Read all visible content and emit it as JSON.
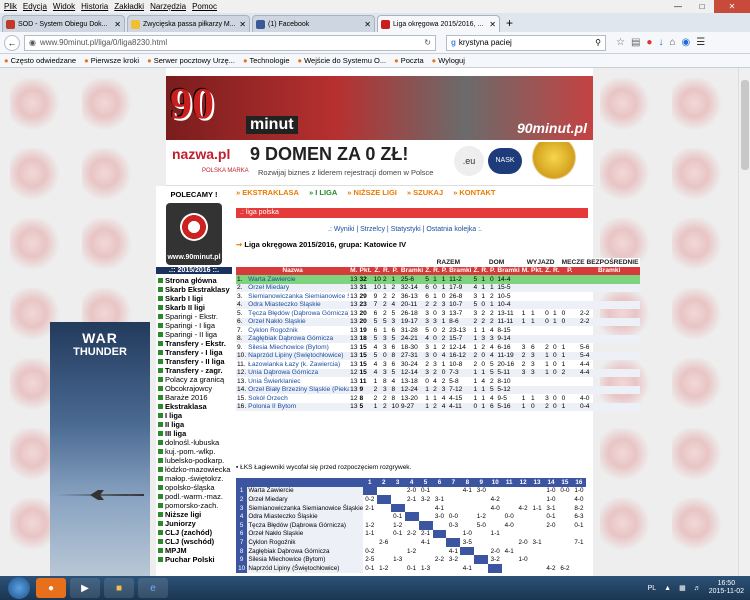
{
  "menu": [
    "Plik",
    "Edycja",
    "Widok",
    "Historia",
    "Zakładki",
    "Narzędzia",
    "Pomoc"
  ],
  "tabs": [
    {
      "label": "SOD - System Obiegu Dok...",
      "color": "#c0392b",
      "active": false
    },
    {
      "label": "Zwycięska passa piłkarzy M...",
      "color": "#f0c030",
      "active": false
    },
    {
      "label": "(1) Facebook",
      "color": "#3b5998",
      "active": false
    },
    {
      "label": "Liga okręgowa 2015/2016, ...",
      "color": "#c81e1e",
      "active": true
    }
  ],
  "url": "www.90minut.pl/liga/0/liga8230.html",
  "search_value": "krystyna paciej",
  "bookmarks": [
    "Często odwiedzane",
    "Pierwsze kroki",
    "Serwer pocztowy Urzę...",
    "Technologie",
    "Wejście do Systemu O...",
    "Poczta",
    "Wyloguj"
  ],
  "banner": {
    "logo": "90",
    "minut": "minut",
    "site": "90minut.pl"
  },
  "ad": {
    "brand": "nazwa.pl",
    "polska": "POLSKA MARKA",
    "headline": "9 DOMEN ZA 0 ZŁ!",
    "sub": "Rozwijaj biznes z liderem rejestracji domen w Polsce",
    "eu": ".eu",
    "nask": "NASK"
  },
  "sidebar": {
    "polecamy": "POLECAMY !",
    "logo": "www.90minut.pl",
    "season": ".:: 2015/2016 ::.",
    "items": [
      {
        "label": "Strona główna",
        "bold": true,
        "sq": true
      },
      {
        "label": "Skarb Ekstraklasy",
        "bold": true,
        "sq": true
      },
      {
        "label": "Skarb I ligi",
        "bold": true,
        "sq": true
      },
      {
        "label": "Skarb II ligi",
        "bold": true,
        "sq": true
      },
      {
        "label": "Sparingi - Ekstr.",
        "bold": false,
        "sq": true
      },
      {
        "label": "Sparingi - I liga",
        "bold": false,
        "sq": true
      },
      {
        "label": "Sparingi - II liga",
        "bold": false,
        "sq": true
      },
      {
        "label": "Transfery - Ekstr.",
        "bold": true,
        "sq": true
      },
      {
        "label": "Transfery - I liga",
        "bold": true,
        "sq": true
      },
      {
        "label": "Transfery - II liga",
        "bold": true,
        "sq": true
      },
      {
        "label": "Transfery - zagr.",
        "bold": true,
        "sq": true
      },
      {
        "label": "Polacy za granicą",
        "bold": false,
        "sq": true
      },
      {
        "label": "Obcokrajowcy",
        "bold": false,
        "sq": true
      },
      {
        "label": "Baraże 2016",
        "bold": false,
        "sq": true
      },
      {
        "label": "Ekstraklasa",
        "bold": true,
        "sq": true
      },
      {
        "label": "I liga",
        "bold": true,
        "sq": true
      },
      {
        "label": "II liga",
        "bold": true,
        "sq": true
      },
      {
        "label": "III liga",
        "bold": true,
        "sq": true
      },
      {
        "label": "dolnośl.-lubuska",
        "bold": false,
        "sq": true
      },
      {
        "label": "kuj.-pom.-wlkp.",
        "bold": false,
        "sq": true
      },
      {
        "label": "lubelsko-podkarp.",
        "bold": false,
        "sq": true
      },
      {
        "label": "łódzko-mazowiecka",
        "bold": false,
        "sq": true
      },
      {
        "label": "małop.-świętokrz.",
        "bold": false,
        "sq": true
      },
      {
        "label": "opolsko-śląska",
        "bold": false,
        "sq": true
      },
      {
        "label": "podl.-warm.-maz.",
        "bold": false,
        "sq": true
      },
      {
        "label": "pomorsko-zach.",
        "bold": false,
        "sq": true
      },
      {
        "label": "Niższe ligi",
        "bold": true,
        "sq": true
      },
      {
        "label": "Juniorzy",
        "bold": true,
        "sq": true
      },
      {
        "label": "CLJ (zachód)",
        "bold": true,
        "sq": true
      },
      {
        "label": "CLJ (wschód)",
        "bold": true,
        "sq": true
      },
      {
        "label": "MPJM",
        "bold": true,
        "sq": true
      },
      {
        "label": "Puchar Polski",
        "bold": true,
        "sq": true
      }
    ]
  },
  "topnav": [
    {
      "label": "» EKSTRAKLASA",
      "cls": "a"
    },
    {
      "label": "» I LIGA",
      "cls": "g"
    },
    {
      "label": "» NIŻSZE LIGI",
      "cls": "a"
    },
    {
      "label": "» SZUKAJ",
      "cls": "a"
    },
    {
      "label": "» KONTAKT",
      "cls": "a"
    }
  ],
  "breadcrumb": ".: liga polska",
  "sublinks": ".: Wyniki | Strzelcy | Statystyki | Ostatnia kolejka :.",
  "league_title": "Liga okręgowa 2015/2016, grupa: Katowice IV",
  "groups": {
    "razem": "RAZEM",
    "dom": "DOM",
    "wyjazd": "WYJAZD",
    "mecze": "MECZE BEZPOŚREDNIE"
  },
  "headers": [
    "Nazwa",
    "M.",
    "Pkt.",
    "Z.",
    "R.",
    "P.",
    "Bramki",
    "Z.",
    "R.",
    "P.",
    "Bramki",
    "Z.",
    "R.",
    "P.",
    "Bramki",
    "M.",
    "Pkt.",
    "Z.",
    "R.",
    "P.",
    "Bramki"
  ],
  "standings": [
    [
      "1.",
      "Warta Zawiercie",
      "13",
      "32",
      "10",
      "2",
      "1",
      "25-6",
      "5",
      "1",
      "1",
      "11-2",
      "5",
      "1",
      "0",
      "14-4",
      "",
      "",
      "",
      "",
      "",
      ""
    ],
    [
      "2.",
      "Orzeł Miedary",
      "13",
      "31",
      "10",
      "1",
      "2",
      "32-14",
      "6",
      "0",
      "1",
      "17-9",
      "4",
      "1",
      "1",
      "15-5",
      "",
      "",
      "",
      "",
      "",
      ""
    ],
    [
      "3.",
      "Siemianowiczanka Siemianowice Śląskie",
      "13",
      "29",
      "9",
      "2",
      "2",
      "36-13",
      "6",
      "1",
      "0",
      "26-8",
      "3",
      "1",
      "2",
      "10-5",
      "",
      "",
      "",
      "",
      "",
      ""
    ],
    [
      "4.",
      "Odra Miasteczko Śląskie",
      "13",
      "23",
      "7",
      "2",
      "4",
      "20-11",
      "2",
      "2",
      "3",
      "10-7",
      "5",
      "0",
      "1",
      "10-4",
      "",
      "",
      "",
      "",
      "",
      ""
    ],
    [
      "5.",
      "Tęcza Błędów (Dąbrowa Górnicza)",
      "13",
      "20",
      "6",
      "2",
      "5",
      "26-18",
      "3",
      "0",
      "3",
      "13-7",
      "3",
      "2",
      "2",
      "13-11",
      "1",
      "1",
      "0",
      "1",
      "0",
      "2-2"
    ],
    [
      "6.",
      "Orzeł Nakło Śląskie",
      "13",
      "20",
      "5",
      "5",
      "3",
      "19-17",
      "3",
      "3",
      "1",
      "8-6",
      "2",
      "2",
      "2",
      "11-11",
      "1",
      "1",
      "0",
      "1",
      "0",
      "2-2"
    ],
    [
      "7.",
      "Cyklon Rogoźnik",
      "13",
      "19",
      "6",
      "1",
      "6",
      "31-28",
      "5",
      "0",
      "2",
      "23-13",
      "1",
      "1",
      "4",
      "8-15",
      "",
      "",
      "",
      "",
      "",
      ""
    ],
    [
      "8.",
      "Zagłębiak Dąbrowa Górnicza",
      "13",
      "18",
      "5",
      "3",
      "5",
      "24-21",
      "4",
      "0",
      "2",
      "15-7",
      "1",
      "3",
      "3",
      "9-14",
      "",
      "",
      "",
      "",
      "",
      ""
    ],
    [
      "9.",
      "Silesia Miechowice (Bytom)",
      "13",
      "15",
      "4",
      "3",
      "6",
      "18-30",
      "3",
      "1",
      "2",
      "12-14",
      "1",
      "2",
      "4",
      "6-16",
      "3",
      "6",
      "2",
      "0",
      "1",
      "5-6"
    ],
    [
      "10.",
      "Naprzód Lipiny (Świętochłowice)",
      "13",
      "15",
      "5",
      "0",
      "8",
      "27-31",
      "3",
      "0",
      "4",
      "16-12",
      "2",
      "0",
      "4",
      "11-19",
      "2",
      "3",
      "1",
      "0",
      "1",
      "5-4"
    ],
    [
      "11.",
      "Łazowianka Łazy (k. Zawiercia)",
      "13",
      "15",
      "4",
      "3",
      "6",
      "30-24",
      "2",
      "3",
      "1",
      "10-8",
      "2",
      "0",
      "5",
      "20-16",
      "2",
      "3",
      "1",
      "0",
      "1",
      "4-4"
    ],
    [
      "12.",
      "Unia Dąbrowa Górnicza",
      "12",
      "15",
      "4",
      "3",
      "5",
      "12-14",
      "3",
      "2",
      "0",
      "7-3",
      "1",
      "1",
      "5",
      "5-11",
      "3",
      "3",
      "1",
      "0",
      "2",
      "4-4"
    ],
    [
      "13.",
      "Unia Świerklaniec",
      "13",
      "11",
      "1",
      "8",
      "4",
      "13-18",
      "0",
      "4",
      "2",
      "5-8",
      "1",
      "4",
      "2",
      "8-10",
      "",
      "",
      "",
      "",
      "",
      ""
    ],
    [
      "14.",
      "Orzeł Biały Brzeziny Śląskie (Piekary Śląskie)",
      "13",
      "9",
      "2",
      "3",
      "8",
      "12-24",
      "1",
      "2",
      "3",
      "7-12",
      "1",
      "1",
      "5",
      "5-12",
      "",
      "",
      "",
      "",
      "",
      ""
    ],
    [
      "15.",
      "Sokół Orzech",
      "12",
      "8",
      "2",
      "2",
      "8",
      "13-20",
      "1",
      "1",
      "4",
      "4-15",
      "1",
      "1",
      "4",
      "9-5",
      "1",
      "1",
      "3",
      "0",
      "0",
      "4-0"
    ],
    [
      "16.",
      "Polonia II Bytom",
      "13",
      "5",
      "1",
      "2",
      "10",
      "9-27",
      "1",
      "2",
      "4",
      "4-11",
      "0",
      "1",
      "6",
      "5-16",
      "1",
      "0",
      "2",
      "0",
      "1",
      "0-4"
    ]
  ],
  "note": "ŁKS Łagiewniki wycofał się przed rozpoczęciem rozgrywek.",
  "grid_cols": [
    "1",
    "2",
    "3",
    "4",
    "5",
    "6",
    "7",
    "8",
    "9",
    "10",
    "11",
    "12",
    "13",
    "14",
    "15",
    "16"
  ],
  "grid": [
    {
      "n": "1",
      "t": "Warta Zawiercie",
      "c": [
        "",
        "",
        "",
        "2-0",
        "0-1",
        "",
        "",
        "4-1",
        "3-0",
        "",
        "",
        "",
        "",
        "1-0",
        "0-0",
        "1-0"
      ]
    },
    {
      "n": "2",
      "t": "Orzeł Miedary",
      "c": [
        "0-2",
        "",
        "",
        "2-1",
        "3-2",
        "3-1",
        "",
        "",
        "",
        "4-2",
        "",
        "",
        "",
        "1-0",
        "",
        "4-0"
      ]
    },
    {
      "n": "3",
      "t": "Siemianowiczanka Siemianowice Śląskie",
      "c": [
        "2-1",
        "",
        "",
        "",
        "",
        "4-1",
        "",
        "",
        "",
        "4-0",
        "",
        "4-2",
        "1-1",
        "3-1",
        "",
        "8-2"
      ]
    },
    {
      "n": "4",
      "t": "Odra Miasteczko Śląskie",
      "c": [
        "",
        "",
        "0-1",
        "",
        "",
        "3-0",
        "0-0",
        "",
        "1-2",
        "",
        "0-0",
        "",
        "",
        "0-1",
        "",
        "6-3"
      ]
    },
    {
      "n": "5",
      "t": "Tęcza Błędów (Dąbrowa Górnicza)",
      "c": [
        "1-2",
        "",
        "1-2",
        "",
        "",
        "",
        "0-3",
        "",
        "5-0",
        "",
        "4-0",
        "",
        "",
        "2-0",
        "",
        "0-1"
      ]
    },
    {
      "n": "6",
      "t": "Orzeł Nakło Śląskie",
      "c": [
        "1-1",
        "",
        "0-1",
        "2-2",
        "2-1",
        "",
        "",
        "1-0",
        "",
        "1-1",
        "",
        "",
        "",
        "",
        "",
        ""
      ]
    },
    {
      "n": "7",
      "t": "Cyklon Rogoźnik",
      "c": [
        "",
        "2-6",
        "",
        "",
        "4-1",
        "",
        "",
        "3-5",
        "",
        "",
        "",
        "2-0",
        "3-1",
        "",
        "",
        "7-1"
      ]
    },
    {
      "n": "8",
      "t": "Zagłębiak Dąbrowa Górnicza",
      "c": [
        "0-2",
        "",
        "",
        "1-2",
        "",
        "",
        "4-1",
        "",
        "",
        "2-0",
        "4-1",
        "",
        "",
        "",
        "",
        ""
      ]
    },
    {
      "n": "9",
      "t": "Silesia Miechowice (Bytom)",
      "c": [
        "2-5",
        "",
        "1-3",
        "",
        "",
        "2-2",
        "3-2",
        "",
        "",
        "3-2",
        "",
        "1-0",
        "",
        "",
        "",
        ""
      ]
    },
    {
      "n": "10",
      "t": "Naprzód Lipiny (Świętochłowice)",
      "c": [
        "0-1",
        "1-2",
        "",
        "0-1",
        "1-3",
        "",
        "",
        "4-1",
        "",
        "",
        "",
        "",
        "",
        "4-2",
        "6-2",
        ""
      ]
    }
  ],
  "taskbar": {
    "lang": "PL",
    "time": "16:50",
    "date": "2015-11-02"
  },
  "warthunder": {
    "line1": "WAR",
    "line2": "THUNDER"
  }
}
